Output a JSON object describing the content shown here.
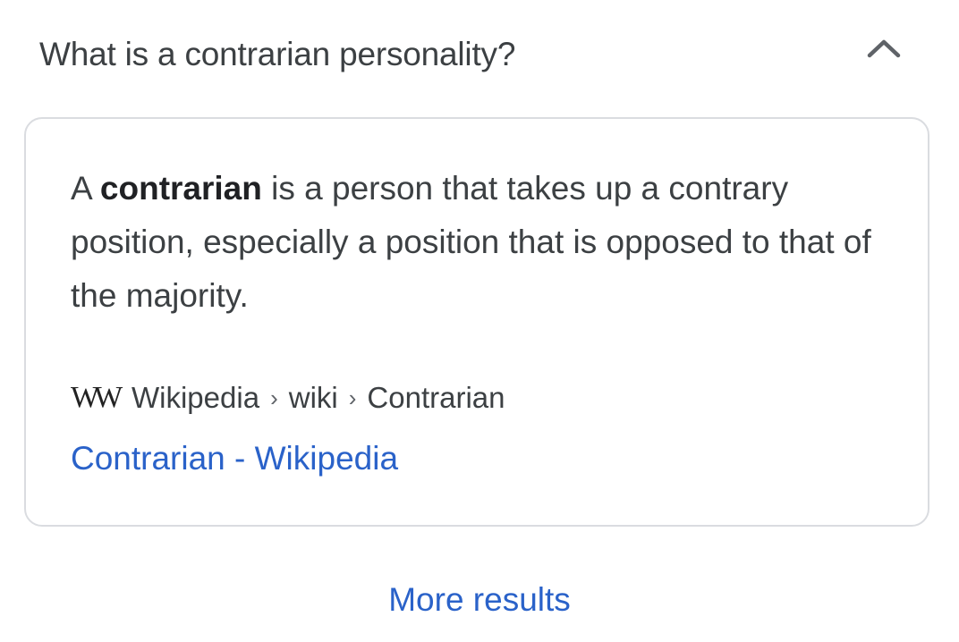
{
  "faq": {
    "question": "What is a contrarian personality?",
    "toggle_icon": "chevron-up-icon"
  },
  "answer": {
    "prefix": "A ",
    "bold_term": "contrarian",
    "suffix": " is a person that takes up a contrary position, especially a position that is opposed to that of the majority."
  },
  "source": {
    "logo_text": "W",
    "logo_icon": "wikipedia-logo-icon",
    "breadcrumbs": [
      "Wikipedia",
      "wiki",
      "Contrarian"
    ],
    "separator": "›",
    "link_title": "Contrarian - Wikipedia"
  },
  "footer": {
    "more_results": "More results"
  },
  "colors": {
    "link": "#2a62c9",
    "text": "#3c4043",
    "card_border": "#dadce0"
  }
}
